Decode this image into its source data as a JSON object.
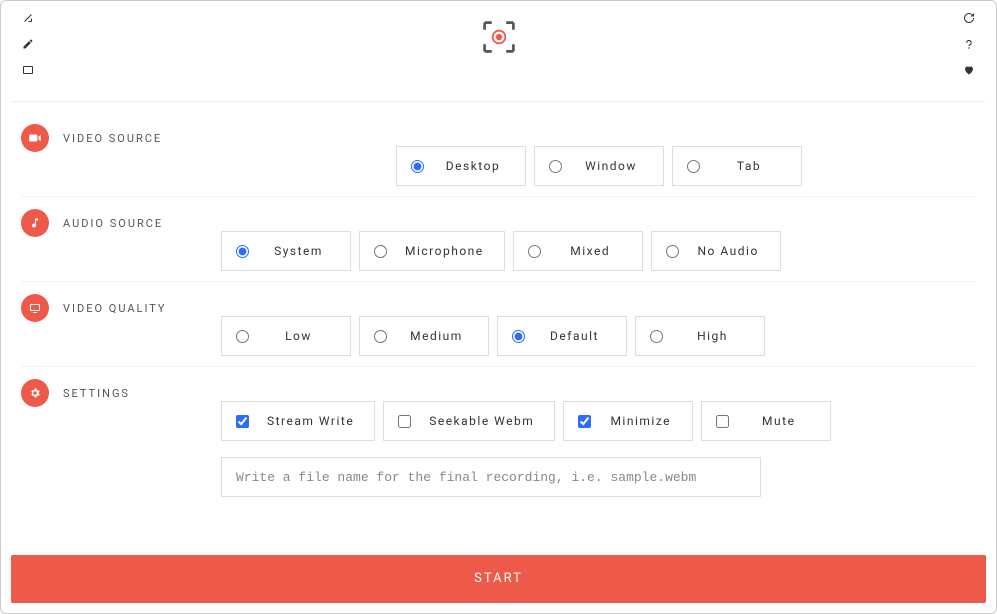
{
  "colors": {
    "accent": "#ee5a4a",
    "radio_accent": "#2b6cff"
  },
  "topbar": {
    "left_icons": [
      "arrow",
      "pencil",
      "window"
    ],
    "right_icons": [
      "refresh",
      "help",
      "heart"
    ]
  },
  "sections": {
    "video_source": {
      "label": "VIDEO SOURCE",
      "options": [
        "Desktop",
        "Window",
        "Tab"
      ],
      "selected": "Desktop"
    },
    "audio_source": {
      "label": "AUDIO SOURCE",
      "options": [
        "System",
        "Microphone",
        "Mixed",
        "No Audio"
      ],
      "selected": "System"
    },
    "video_quality": {
      "label": "VIDEO QUALITY",
      "options": [
        "Low",
        "Medium",
        "Default",
        "High"
      ],
      "selected": "Default"
    },
    "settings": {
      "label": "SETTINGS",
      "checks": [
        {
          "label": "Stream Write",
          "checked": true
        },
        {
          "label": "Seekable Webm",
          "checked": false
        },
        {
          "label": "Minimize",
          "checked": true
        },
        {
          "label": "Mute",
          "checked": false
        }
      ],
      "filename_placeholder": "Write a file name for the final recording, i.e. sample.webm",
      "filename_value": ""
    }
  },
  "start_label": "START"
}
